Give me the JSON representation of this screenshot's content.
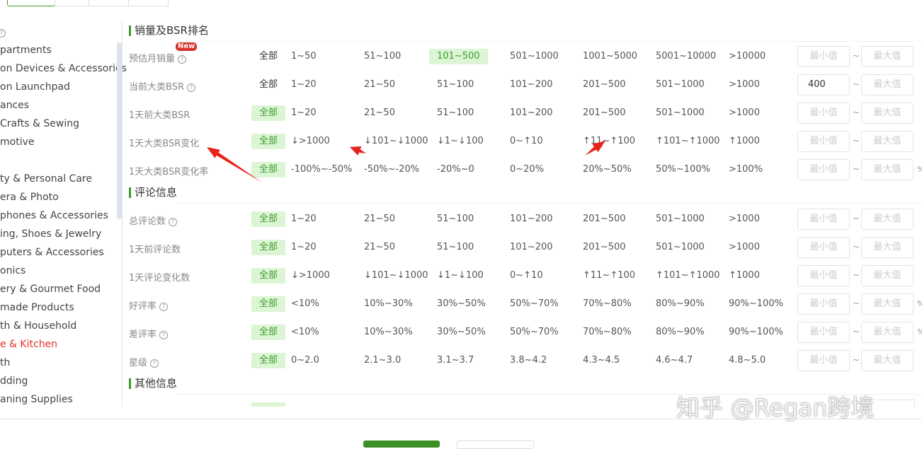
{
  "top_tabs": [
    "",
    "",
    "",
    ""
  ],
  "sidebar": {
    "items": [
      {
        "label": "partments"
      },
      {
        "label": "on Devices & Accessories"
      },
      {
        "label": "on Launchpad"
      },
      {
        "label": "ances"
      },
      {
        "label": "Crafts & Sewing"
      },
      {
        "label": "motive"
      },
      {
        "label": ""
      },
      {
        "label": "ty & Personal Care"
      },
      {
        "label": "era & Photo"
      },
      {
        "label": "phones & Accessories"
      },
      {
        "label": "ing, Shoes & Jewelry"
      },
      {
        "label": "puters & Accessories"
      },
      {
        "label": "onics"
      },
      {
        "label": "ery & Gourmet Food"
      },
      {
        "label": "made Products"
      },
      {
        "label": "th & Household"
      },
      {
        "label": "e & Kitchen",
        "active": true
      },
      {
        "label": "th"
      },
      {
        "label": "dding"
      },
      {
        "label": "aning Supplies"
      }
    ]
  },
  "sections": [
    {
      "title": "销量及BSR排名",
      "rows": [
        {
          "label": "预估月销量",
          "help": true,
          "badge": "New",
          "all": "全部",
          "all_active": false,
          "options": [
            "1~50",
            "51~100",
            "101~500",
            "501~1000",
            "1001~5000",
            "5001~10000",
            ">10000"
          ],
          "selected": 2,
          "min": "",
          "max": "",
          "suffix": ""
        },
        {
          "label": "当前大类BSR",
          "help": true,
          "all": "全部",
          "all_active": false,
          "options": [
            "1~20",
            "21~50",
            "51~100",
            "101~200",
            "201~500",
            "501~1000",
            ">1000"
          ],
          "min": "400",
          "max": "",
          "suffix": ""
        },
        {
          "label": "1天前大类BSR",
          "all": "全部",
          "all_active": true,
          "options": [
            "1~20",
            "21~50",
            "51~100",
            "101~200",
            "201~500",
            "501~1000",
            ">1000"
          ],
          "min": "",
          "max": "",
          "suffix": ""
        },
        {
          "label": "1天大类BSR变化",
          "all": "全部",
          "all_active": true,
          "options": [
            "↓>1000",
            "↓101~↓1000",
            "↓1~↓100",
            "0~↑10",
            "↑11~↑100",
            "↑101~↑1000",
            "↑1000"
          ],
          "min": "",
          "max": "",
          "suffix": ""
        },
        {
          "label": "1天大类BSR变化率",
          "all": "全部",
          "all_active": true,
          "options": [
            "-100%~-50%",
            "-50%~-20%",
            "-20%~0",
            "0~20%",
            "20%~50%",
            "50%~100%",
            ">100%"
          ],
          "min": "",
          "max": "",
          "suffix": "%"
        }
      ]
    },
    {
      "title": "评论信息",
      "rows": [
        {
          "label": "总评论数",
          "help": true,
          "all": "全部",
          "all_active": true,
          "options": [
            "1~20",
            "21~50",
            "51~100",
            "101~200",
            "201~500",
            "501~1000",
            ">1000"
          ],
          "min": "",
          "max": "",
          "suffix": ""
        },
        {
          "label": "1天前评论数",
          "all": "全部",
          "all_active": true,
          "options": [
            "1~20",
            "21~50",
            "51~100",
            "101~200",
            "201~500",
            "501~1000",
            ">1000"
          ],
          "min": "",
          "max": "",
          "suffix": ""
        },
        {
          "label": "1天评论变化数",
          "all": "全部",
          "all_active": true,
          "options": [
            "↓>1000",
            "↓101~↓1000",
            "↓1~↓100",
            "0~↑10",
            "↑11~↑100",
            "↑101~↑1000",
            "↑1000"
          ],
          "min": "",
          "max": "",
          "suffix": ""
        },
        {
          "label": "好评率",
          "help": true,
          "all": "全部",
          "all_active": true,
          "options": [
            "<10%",
            "10%~30%",
            "30%~50%",
            "50%~70%",
            "70%~80%",
            "80%~90%",
            "90%~100%"
          ],
          "min": "",
          "max": "",
          "suffix": "%"
        },
        {
          "label": "差评率",
          "help": true,
          "all": "全部",
          "all_active": true,
          "options": [
            "<10%",
            "10%~30%",
            "30%~50%",
            "50%~70%",
            "70%~80%",
            "80%~90%",
            "90%~100%"
          ],
          "min": "",
          "max": "",
          "suffix": "%"
        },
        {
          "label": "星级",
          "help": true,
          "all": "全部",
          "all_active": true,
          "options": [
            "0~2.0",
            "2.1~3.0",
            "3.1~3.7",
            "3.8~4.2",
            "4.3~4.5",
            "4.6~4.7",
            "4.8~5.0"
          ],
          "min": "",
          "max": "",
          "suffix": ""
        }
      ]
    },
    {
      "title": "其他信息",
      "rows": []
    }
  ],
  "placeholders": {
    "min": "最小值",
    "max": "最大值"
  },
  "tilde": "~",
  "watermark": "知乎 @Regan跨境",
  "colors": {
    "accent": "#3c9a2c",
    "selected_bg": "#dcf5d4",
    "annotation": "#e8231b",
    "active_category": "#e0302a"
  }
}
